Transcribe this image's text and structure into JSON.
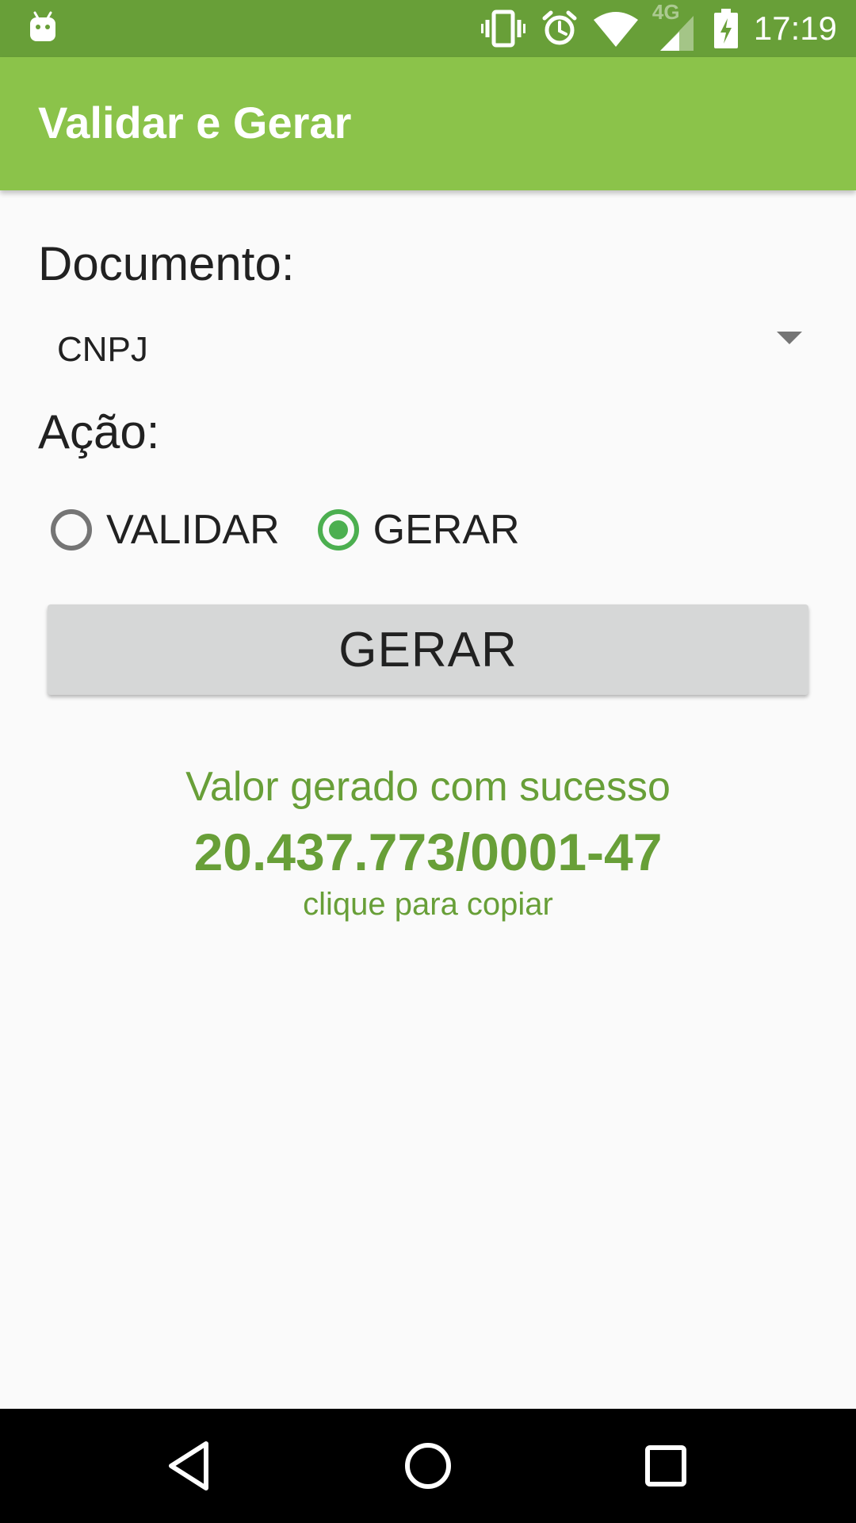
{
  "status_bar": {
    "time": "17:19",
    "network_label": "4G",
    "icons": [
      "android-notification-icon",
      "vibrate-icon",
      "alarm-icon",
      "wifi-icon",
      "cell-signal-icon",
      "battery-charging-icon"
    ]
  },
  "app_bar": {
    "title": "Validar e Gerar"
  },
  "form": {
    "document_label": "Documento:",
    "document_selected": "CNPJ",
    "action_label": "Ação:",
    "radio_options": [
      {
        "label": "VALIDAR",
        "checked": false
      },
      {
        "label": "GERAR",
        "checked": true
      }
    ],
    "button_label": "GERAR"
  },
  "result": {
    "message": "Valor gerado com sucesso",
    "value": "20.437.773/0001-47",
    "hint": "clique para copiar"
  },
  "nav_bar": {
    "buttons": [
      "back-icon",
      "home-icon",
      "recents-icon"
    ]
  },
  "colors": {
    "status_bar": "#689f38",
    "app_bar": "#8bc34a",
    "accent": "#4caf50",
    "result_text": "#689f38",
    "button_bg": "#d6d7d7"
  }
}
